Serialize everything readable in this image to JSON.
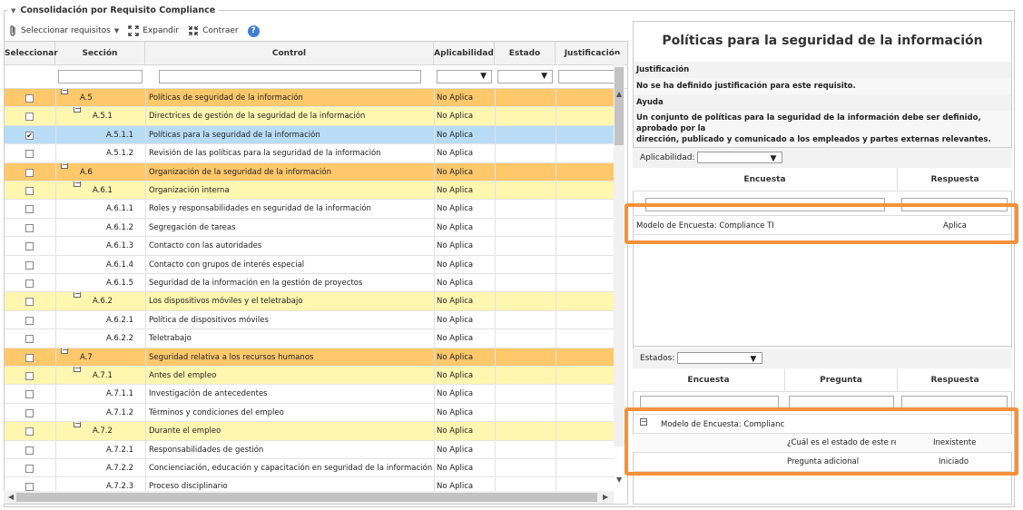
{
  "panel_title": "Consolidación por Requisito Compliance",
  "toolbar": {
    "select_label": "Seleccionar requisitos",
    "expand_label": "Expandir",
    "collapse_label": "Contraer"
  },
  "grid": {
    "columns": [
      "Seleccionar",
      "Sección",
      "Control",
      "Aplicabilidad",
      "Estado",
      "Justificación"
    ],
    "rows": [
      {
        "level": 1,
        "checked": false,
        "section": "A.5",
        "control": "Políticas de seguridad de la información",
        "aplicabilidad": "No Aplica"
      },
      {
        "level": 2,
        "checked": false,
        "section": "A.5.1",
        "control": "Directrices de gestión de la seguridad de la información",
        "aplicabilidad": "No Aplica"
      },
      {
        "level": 3,
        "checked": true,
        "selected": true,
        "section": "A.5.1.1",
        "control": "Políticas para la seguridad de la información",
        "aplicabilidad": "No Aplica"
      },
      {
        "level": 3,
        "checked": false,
        "section": "A.5.1.2",
        "control": "Revisión de las políticas para la seguridad de la información",
        "aplicabilidad": "No Aplica"
      },
      {
        "level": 1,
        "checked": false,
        "section": "A.6",
        "control": "Organización de la seguridad de la información",
        "aplicabilidad": "No Aplica"
      },
      {
        "level": 2,
        "checked": false,
        "section": "A.6.1",
        "control": "Organización interna",
        "aplicabilidad": "No Aplica"
      },
      {
        "level": 3,
        "checked": false,
        "section": "A.6.1.1",
        "control": "Roles y responsabilidades en seguridad de la información",
        "aplicabilidad": "No Aplica"
      },
      {
        "level": 3,
        "checked": false,
        "section": "A.6.1.2",
        "control": "Segregación de tareas",
        "aplicabilidad": "No Aplica"
      },
      {
        "level": 3,
        "checked": false,
        "section": "A.6.1.3",
        "control": "Contacto con las autoridades",
        "aplicabilidad": "No Aplica"
      },
      {
        "level": 3,
        "checked": false,
        "section": "A.6.1.4",
        "control": "Contacto con grupos de interés especial",
        "aplicabilidad": "No Aplica"
      },
      {
        "level": 3,
        "checked": false,
        "section": "A.6.1.5",
        "control": "Seguridad de la información en la gestión de proyectos",
        "aplicabilidad": "No Aplica"
      },
      {
        "level": 2,
        "checked": false,
        "section": "A.6.2",
        "control": "Los dispositivos móviles y el teletrabajo",
        "aplicabilidad": "No Aplica"
      },
      {
        "level": 3,
        "checked": false,
        "section": "A.6.2.1",
        "control": "Política de dispositivos móviles",
        "aplicabilidad": "No Aplica"
      },
      {
        "level": 3,
        "checked": false,
        "section": "A.6.2.2",
        "control": "Teletrabajo",
        "aplicabilidad": "No Aplica"
      },
      {
        "level": 1,
        "checked": false,
        "section": "A.7",
        "control": "Seguridad relativa a los recursos humanos",
        "aplicabilidad": "No Aplica"
      },
      {
        "level": 2,
        "checked": false,
        "section": "A.7.1",
        "control": "Antes del empleo",
        "aplicabilidad": "No Aplica"
      },
      {
        "level": 3,
        "checked": false,
        "section": "A.7.1.1",
        "control": "Investigación de antecedentes",
        "aplicabilidad": "No Aplica"
      },
      {
        "level": 3,
        "checked": false,
        "section": "A.7.1.2",
        "control": "Términos y condiciones del empleo",
        "aplicabilidad": "No Aplica"
      },
      {
        "level": 2,
        "checked": false,
        "section": "A.7.2",
        "control": "Durante el empleo",
        "aplicabilidad": "No Aplica"
      },
      {
        "level": 3,
        "checked": false,
        "section": "A.7.2.1",
        "control": "Responsabilidades de gestión",
        "aplicabilidad": "No Aplica"
      },
      {
        "level": 3,
        "checked": false,
        "section": "A.7.2.2",
        "control": "Concienciación, educación y capacitación en seguridad de la información",
        "aplicabilidad": "No Aplica"
      },
      {
        "level": 3,
        "checked": false,
        "section": "A.7.2.3",
        "control": "Proceso disciplinario",
        "aplicabilidad": "No Aplica"
      }
    ]
  },
  "detail": {
    "title": "Políticas para la seguridad de la información",
    "justification_label": "Justificación",
    "justification_text": "No se ha definido justificación para este requisito.",
    "help_label": "Ayuda",
    "help_text_line1": "Un conjunto de políticas para la seguridad de la información debe ser definido, aprobado por la",
    "help_text_line2": "dirección, publicado y comunicado a los empleados y partes externas relevantes."
  },
  "applicability": {
    "filter_label": "Aplicabilidad:",
    "columns": [
      "Encuesta",
      "Respuesta"
    ],
    "rows": [
      {
        "encuesta": "Modelo de Encuesta: Compliance TI",
        "respuesta": "Aplica"
      }
    ]
  },
  "states": {
    "filter_label": "Estados:",
    "columns": [
      "Encuesta",
      "Pregunta",
      "Respuesta"
    ],
    "group": "Modelo de Encuesta: Complianc",
    "rows": [
      {
        "pregunta": "¿Cuál es el estado de este re",
        "respuesta": "Inexistente"
      },
      {
        "pregunta": "Pregunta adicional",
        "respuesta": "Iniciado"
      }
    ]
  },
  "colors": {
    "level1": "#ffc86b",
    "level2": "#fff6b0",
    "selected": "#b9dcf6",
    "highlight": "#f5913a",
    "help_icon": "#3f7fd6"
  }
}
